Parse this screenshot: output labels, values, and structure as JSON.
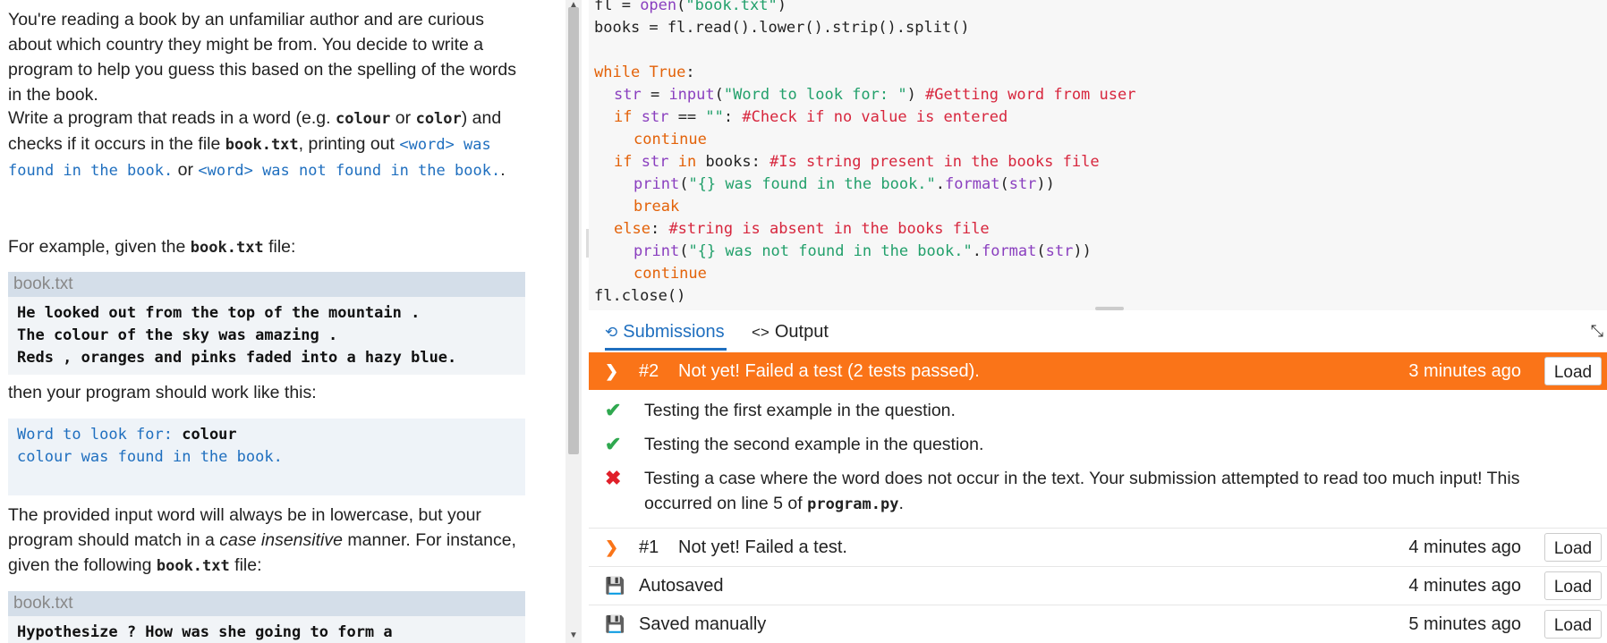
{
  "question": {
    "p1": "You're reading a book by an unfamiliar author and are curious about which country they might be from. You decide to write a program to help you guess this based on the spelling of the words in the book.",
    "p2_a": "Write a program that reads in a word (e.g. ",
    "p2_colour": "colour",
    "p2_or": " or ",
    "p2_color": "color",
    "p2_b": ") and checks if it occurs in the file ",
    "p2_file": "book.txt",
    "p2_c": ", printing out ",
    "p2_found": "<word> was found in the book.",
    "p2_or2": " or ",
    "p2_notfound": "<word> was not found in the book.",
    "p2_end": ".",
    "p3_a": "For example, given the ",
    "p3_file": "book.txt",
    "p3_b": " file:",
    "file1_name": "book.txt",
    "file1_lines": "He looked out from the top of the mountain .\nThe colour of the sky was amazing .\nReds , oranges and pinks faded into a hazy blue.",
    "p4": "then your program should work like this:",
    "example_prompt": "Word to look for: ",
    "example_input": "colour",
    "example_output": "colour was found in the book.",
    "p5_a": "The provided input word will always be in lowercase, but your program should match in a ",
    "p5_em": "case insensitive",
    "p5_b": " manner. For instance, given the following ",
    "p5_file": "book.txt",
    "p5_c": " file:",
    "file2_name": "book.txt",
    "file2_line": "Hypothesize ? How was she going to form a"
  },
  "editor": {
    "l1_a": "fl = ",
    "l1_fn": "open",
    "l1_b": "(",
    "l1_str": "\"book.txt\"",
    "l1_c": ")",
    "l2": "books = fl.read().lower().strip().split()",
    "l4_kw": "while",
    "l4_true": "True",
    "l4_end": ":",
    "l5_var": "str",
    "l5_eq": " = ",
    "l5_fn": "input",
    "l5_str": "\"Word to look for: \"",
    "l5_cm": "#Getting word from user",
    "l6_kw": "if",
    "l6_var": "str",
    "l6_op": " == ",
    "l6_str": "\"\"",
    "l6_cm": "#Check if no value is entered",
    "l7_kw": "continue",
    "l8_kw": "if",
    "l8_var": "str",
    "l8_in": "in",
    "l8_b": "books:",
    "l8_cm": "#Is string present in the books file",
    "l9_fn": "print",
    "l9_str": "\"{} was found in the book.\"",
    "l9_fmt": "format",
    "l9_var": "str",
    "l10_kw": "break",
    "l11_kw": "else",
    "l11_cm": "#string is absent in the books file",
    "l12_fn": "print",
    "l12_str": "\"{} was not found in the book.\"",
    "l12_fmt": "format",
    "l12_var": "str",
    "l13_kw": "continue",
    "l14": "fl.close()"
  },
  "tabs": {
    "submissions": "Submissions",
    "output": "Output",
    "submissions_icon": "history-icon",
    "output_icon": "code-icon"
  },
  "submissions": [
    {
      "num": "#2",
      "title": "Not yet! Failed a test (2 tests passed).",
      "time": "3 minutes ago",
      "load": "Load"
    },
    {
      "num": "#1",
      "title": "Not yet! Failed a test.",
      "time": "4 minutes ago",
      "load": "Load"
    }
  ],
  "tests": [
    {
      "status": "pass",
      "text": "Testing the first example in the question."
    },
    {
      "status": "pass",
      "text": "Testing the second example in the question."
    },
    {
      "status": "fail",
      "text_a": "Testing a case where the word does not occur in the text. Your submission attempted to read too much input! This occurred on line 5 of ",
      "file": "program.py",
      "text_b": "."
    }
  ],
  "saves": [
    {
      "label": "Autosaved",
      "time": "4 minutes ago",
      "load": "Load"
    },
    {
      "label": "Saved manually",
      "time": "5 minutes ago",
      "load": "Load"
    }
  ],
  "colors": {
    "accent": "#fa7418",
    "link": "#1f6fbf",
    "pass": "#2fa84f",
    "fail": "#e0202a"
  }
}
